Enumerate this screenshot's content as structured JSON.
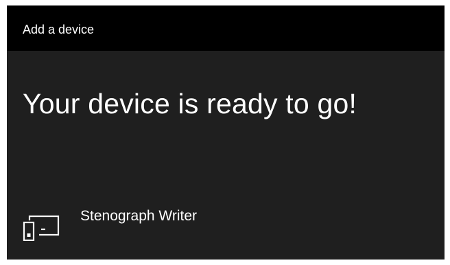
{
  "window": {
    "title": "Add a device"
  },
  "main": {
    "heading": "Your device is ready to go!",
    "device": {
      "name": "Stenograph Writer",
      "icon": "device-icon"
    }
  },
  "colors": {
    "titlebar_bg": "#000000",
    "window_bg": "#1f1f1f",
    "text": "#ffffff"
  }
}
